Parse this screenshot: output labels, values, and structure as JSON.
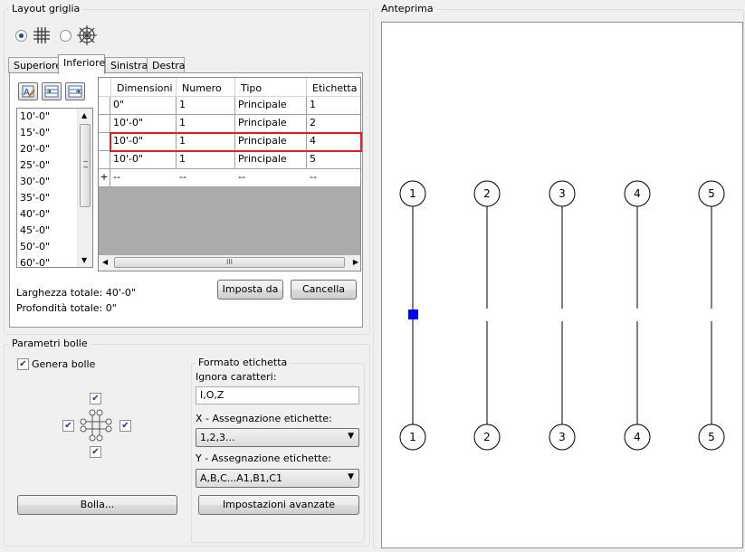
{
  "layout_group": {
    "title": "Layout griglia",
    "tabs": [
      "Superiore",
      "Inferiore",
      "Sinistra",
      "Destra"
    ],
    "active_tab": "Inferiore",
    "dimension_list": [
      "10'-0\"",
      "15'-0\"",
      "20'-0\"",
      "25'-0\"",
      "30'-0\"",
      "35'-0\"",
      "40'-0\"",
      "45'-0\"",
      "50'-0\"",
      "60'-0\""
    ],
    "table": {
      "headers": [
        "Dimensioni",
        "Numero",
        "Tipo",
        "Etichetta"
      ],
      "rows": [
        [
          "0\"",
          "1",
          "Principale",
          "1"
        ],
        [
          "10'-0\"",
          "1",
          "Principale",
          "2"
        ],
        [
          "10'-0\"",
          "1",
          "Principale",
          "4"
        ],
        [
          "10'-0\"",
          "1",
          "Principale",
          "5"
        ]
      ],
      "new_row": [
        "--",
        "--",
        "--",
        "--"
      ],
      "new_row_marker": "+",
      "hscroll_grip": "III"
    },
    "total_width": "Larghezza totale: 40'-0\"",
    "total_depth": "Profondità totale: 0\"",
    "set_button": "Imposta da",
    "delete_button": "Cancella"
  },
  "bubbles_group": {
    "title": "Parametri bolle",
    "generate_label": "Genera bolle",
    "button_bubble": "Bolla...",
    "label_format": {
      "title": "Formato etichetta",
      "ignore_chars_label": "Ignora caratteri:",
      "ignore_chars_value": "I,O,Z",
      "x_label": "X - Assegnazione etichette:",
      "x_value": "1,2,3...",
      "y_label": "Y - Assegnazione etichette:",
      "y_value": "A,B,C...A1,B1,C1",
      "advanced_button": "Impostazioni avanzate"
    }
  },
  "preview": {
    "title": "Anteprima",
    "top_bubbles": [
      "1",
      "2",
      "3",
      "4",
      "5"
    ],
    "bottom_bubbles": [
      "1",
      "2",
      "3",
      "4",
      "5"
    ]
  },
  "colors": {
    "highlight_border": "#e02020",
    "selection_marker": "#0000ff"
  }
}
